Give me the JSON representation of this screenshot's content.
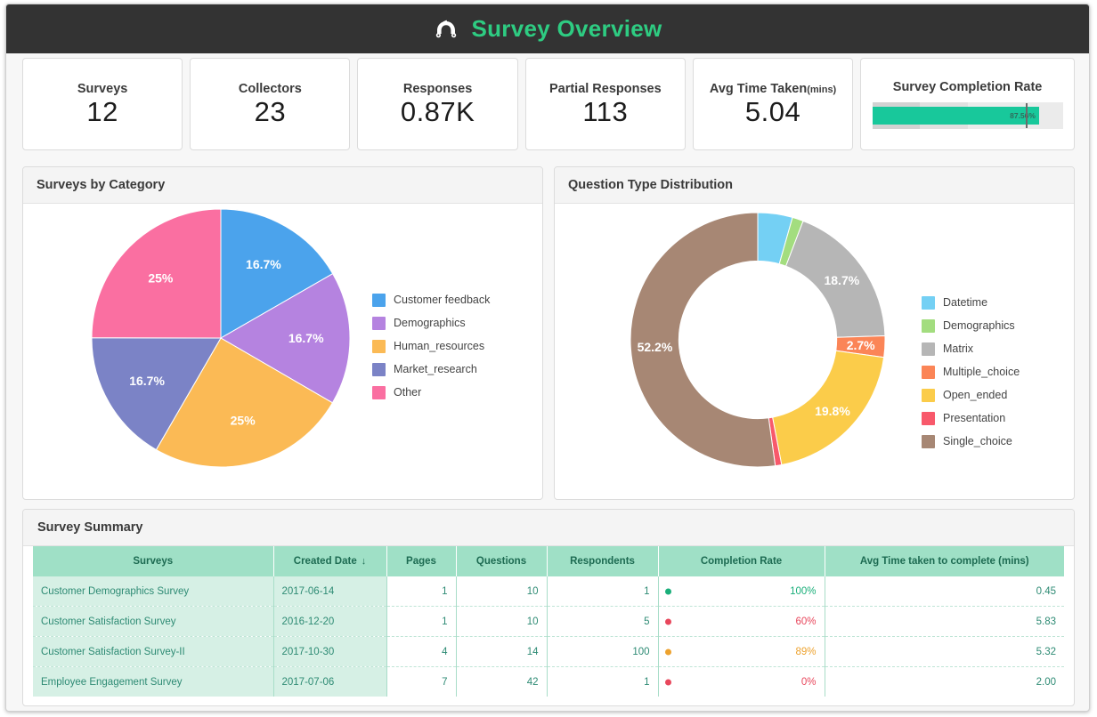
{
  "header": {
    "title": "Survey Overview",
    "logo_icon": "survey-arch-logo-icon",
    "background": "#333333",
    "title_color": "#2ecc82"
  },
  "kpis": [
    {
      "label": "Surveys",
      "value": "12"
    },
    {
      "label": "Collectors",
      "value": "23"
    },
    {
      "label": "Responses",
      "value": "0.87K"
    },
    {
      "label": "Partial Responses",
      "value": "113"
    },
    {
      "label": "Avg Time Taken",
      "sub_label": "(mins)",
      "value": "5.04"
    }
  ],
  "completion_rate": {
    "label": "Survey Completion Rate",
    "value_text": "87.56%",
    "value_pct": 87.56,
    "target_pct": 80.5,
    "fill_color": "#18c89b",
    "bands": [
      25,
      25,
      50
    ]
  },
  "panels": {
    "category_title": "Surveys by Category",
    "qtype_title": "Question Type Distribution",
    "summary_title": "Survey Summary"
  },
  "chart_data": [
    {
      "type": "pie",
      "title": "Surveys by Category",
      "categories": [
        "Customer feedback",
        "Demographics",
        "Human_resources",
        "Market_research",
        "Other"
      ],
      "values": [
        16.7,
        16.7,
        25,
        16.7,
        25
      ],
      "labels": [
        "16.7%",
        "16.7%",
        "25%",
        "16.7%",
        "25%"
      ],
      "colors": [
        "#4ba3ec",
        "#b583e0",
        "#fbba55",
        "#7b83c6",
        "#fa6fa1"
      ],
      "legend_position": "right",
      "start_angle_deg": 0,
      "direction": "clockwise"
    },
    {
      "type": "pie",
      "variant": "donut",
      "title": "Question Type Distribution",
      "categories": [
        "Datetime",
        "Demographics",
        "Matrix",
        "Multiple_choice",
        "Open_ended",
        "Presentation",
        "Single_choice"
      ],
      "values": [
        4.4,
        1.4,
        18.7,
        2.7,
        19.8,
        0.8,
        52.2
      ],
      "labels": [
        "",
        "",
        "18.7%",
        "2.7%",
        "19.8%",
        "",
        "52.2%"
      ],
      "colors": [
        "#74d0f4",
        "#a3dd7f",
        "#b6b6b6",
        "#fb8557",
        "#fbcc4a",
        "#f8596b",
        "#a78774"
      ],
      "legend_position": "right",
      "inner_radius_ratio": 0.62,
      "start_angle_deg": 0,
      "direction": "clockwise"
    }
  ],
  "summary_table": {
    "columns": [
      "Surveys",
      "Created Date",
      "Pages",
      "Questions",
      "Respondents",
      "Completion Rate",
      "Avg Time taken to complete (mins)"
    ],
    "sorted_column": "Created Date",
    "sort_direction_icon": "↓",
    "rows": [
      {
        "survey": "Customer Demographics Survey",
        "created_date": "2017-06-14",
        "pages": "1",
        "questions": "10",
        "respondents": "1",
        "completion_rate": "100%",
        "status_color": "#1aaf7a",
        "rate_text_color": "#1aaf7a",
        "avg_time": "0.45"
      },
      {
        "survey": "Customer Satisfaction Survey",
        "created_date": "2016-12-20",
        "pages": "1",
        "questions": "10",
        "respondents": "5",
        "completion_rate": "60%",
        "status_color": "#e8475c",
        "rate_text_color": "#e8475c",
        "avg_time": "5.83"
      },
      {
        "survey": "Customer Satisfaction Survey-II",
        "created_date": "2017-10-30",
        "pages": "4",
        "questions": "14",
        "respondents": "100",
        "completion_rate": "89%",
        "status_color": "#eda22e",
        "rate_text_color": "#eda22e",
        "avg_time": "5.32"
      },
      {
        "survey": "Employee Engagement Survey",
        "created_date": "2017-07-06",
        "pages": "7",
        "questions": "42",
        "respondents": "1",
        "completion_rate": "0%",
        "status_color": "#e8475c",
        "rate_text_color": "#e8475c",
        "avg_time": "2.00"
      }
    ]
  }
}
